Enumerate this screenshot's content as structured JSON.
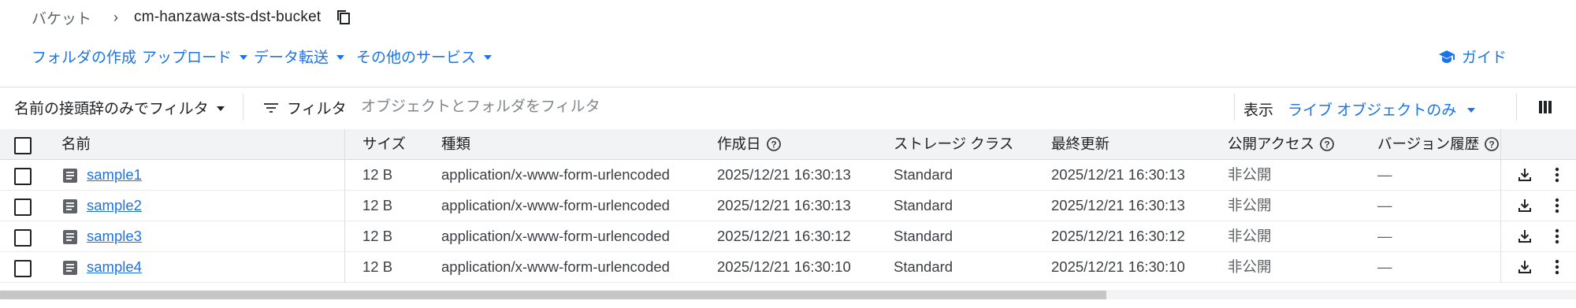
{
  "breadcrumb": {
    "parent": "バケット",
    "separator": "›",
    "current": "cm-hanzawa-sts-dst-bucket",
    "copy_icon": "copy-icon"
  },
  "actions": {
    "create_folder": "フォルダの作成",
    "upload": "アップロード",
    "transfer": "データ転送",
    "other_services": "その他のサービス",
    "guide": "ガイド"
  },
  "filterbar": {
    "prefix_filter": "名前の接頭辞のみでフィルタ",
    "filter_label": "フィルタ",
    "filter_placeholder": "オブジェクトとフォルダをフィルタ",
    "show_label": "表示",
    "show_value": "ライブ オブジェクトのみ"
  },
  "table": {
    "headers": {
      "name": "名前",
      "size": "サイズ",
      "type": "種類",
      "created": "作成日",
      "storage_class": "ストレージ クラス",
      "updated": "最終更新",
      "public_access": "公開アクセス",
      "version_history": "バージョン履歴"
    },
    "rows": [
      {
        "name": "sample1",
        "size": "12 B",
        "type": "application/x-www-form-urlencoded",
        "created": "2025/12/21 16:30:13",
        "storage_class": "Standard",
        "updated": "2025/12/21 16:30:13",
        "public_access": "非公開",
        "version_history": "—"
      },
      {
        "name": "sample2",
        "size": "12 B",
        "type": "application/x-www-form-urlencoded",
        "created": "2025/12/21 16:30:13",
        "storage_class": "Standard",
        "updated": "2025/12/21 16:30:13",
        "public_access": "非公開",
        "version_history": "—"
      },
      {
        "name": "sample3",
        "size": "12 B",
        "type": "application/x-www-form-urlencoded",
        "created": "2025/12/21 16:30:12",
        "storage_class": "Standard",
        "updated": "2025/12/21 16:30:12",
        "public_access": "非公開",
        "version_history": "—"
      },
      {
        "name": "sample4",
        "size": "12 B",
        "type": "application/x-www-form-urlencoded",
        "created": "2025/12/21 16:30:10",
        "storage_class": "Standard",
        "updated": "2025/12/21 16:30:10",
        "public_access": "非公開",
        "version_history": "—"
      }
    ]
  },
  "colors": {
    "accent": "#1a73e8",
    "header_bg": "#f1f3f4",
    "border": "#dadce0"
  }
}
